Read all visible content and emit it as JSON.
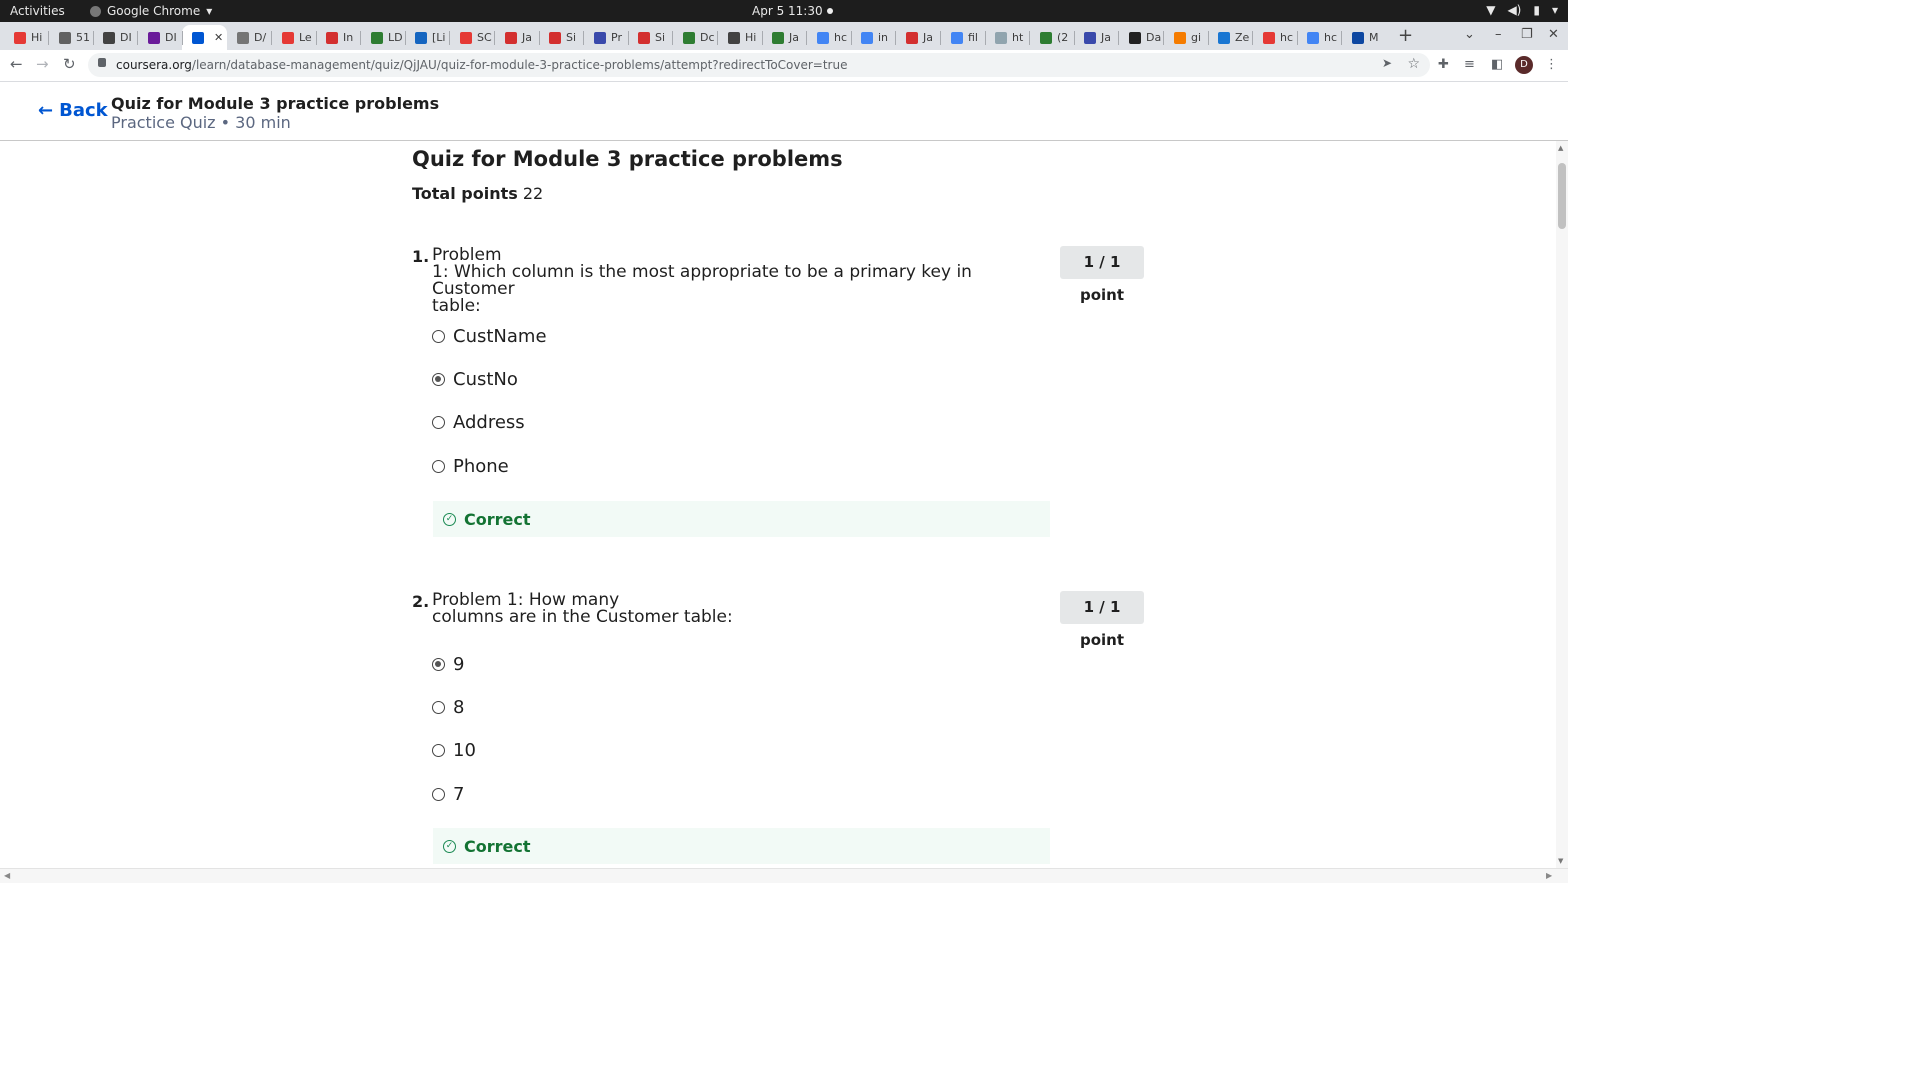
{
  "os": {
    "activities": "Activities",
    "app": "Google Chrome",
    "clock": "Apr 5  11:30"
  },
  "tabs": [
    {
      "label": "Hi",
      "color": "#e53935"
    },
    {
      "label": "51",
      "color": "#616161"
    },
    {
      "label": "DI",
      "color": "#424242"
    },
    {
      "label": "DI",
      "color": "#6a1b9a"
    },
    {
      "label": "",
      "color": "#0056d2",
      "active": true
    },
    {
      "label": "D/",
      "color": "#757575"
    },
    {
      "label": "Le",
      "color": "#e53935"
    },
    {
      "label": "In",
      "color": "#d32f2f"
    },
    {
      "label": "LD",
      "color": "#2e7d32"
    },
    {
      "label": "[Li",
      "color": "#1565c0"
    },
    {
      "label": "SC",
      "color": "#e53935"
    },
    {
      "label": "Ja",
      "color": "#d32f2f"
    },
    {
      "label": "Si",
      "color": "#d32f2f"
    },
    {
      "label": "Pr",
      "color": "#3949ab"
    },
    {
      "label": "Si",
      "color": "#d32f2f"
    },
    {
      "label": "Dc",
      "color": "#2e7d32"
    },
    {
      "label": "Hi",
      "color": "#424242"
    },
    {
      "label": "Ja",
      "color": "#2e7d32"
    },
    {
      "label": "hc",
      "color": "#4285f4"
    },
    {
      "label": "in",
      "color": "#4285f4"
    },
    {
      "label": "Ja",
      "color": "#d32f2f"
    },
    {
      "label": "fil",
      "color": "#4285f4"
    },
    {
      "label": "ht",
      "color": "#90a4ae"
    },
    {
      "label": "(2",
      "color": "#2e7d32"
    },
    {
      "label": "Ja",
      "color": "#3949ab"
    },
    {
      "label": "Da",
      "color": "#212121"
    },
    {
      "label": "gi",
      "color": "#f57c00"
    },
    {
      "label": "Ze",
      "color": "#1976d2"
    },
    {
      "label": "hc",
      "color": "#e53935"
    },
    {
      "label": "hc",
      "color": "#4285f4"
    },
    {
      "label": "M",
      "color": "#0d47a1"
    }
  ],
  "browser": {
    "url_host": "coursera.org",
    "url_path": "/learn/database-management/quiz/QjJAU/quiz-for-module-3-practice-problems/attempt?redirectToCover=true",
    "avatar_letter": "D"
  },
  "header": {
    "back_label": "Back",
    "title": "Quiz for Module 3 practice problems",
    "subtitle": "Practice Quiz • 30 min"
  },
  "quiz": {
    "title": "Quiz for Module 3 practice problems",
    "total_label": "Total points",
    "total_value": "22",
    "questions": [
      {
        "number": "1.",
        "text_line1": "Problem",
        "text_line2": "1: Which column is the most appropriate to be a primary key in Customer",
        "text_line3": "table:",
        "points": "1 / 1 point",
        "options": [
          "CustName",
          "CustNo",
          "Address",
          "Phone"
        ],
        "selected_index": 1,
        "feedback": "Correct"
      },
      {
        "number": "2.",
        "text_line1": "Problem 1: How many",
        "text_line2": "columns are in the Customer table:",
        "text_line3": "",
        "points": "1 / 1 point",
        "options": [
          "9",
          "8",
          "10",
          "7"
        ],
        "selected_index": 0,
        "feedback": "Correct"
      }
    ]
  }
}
